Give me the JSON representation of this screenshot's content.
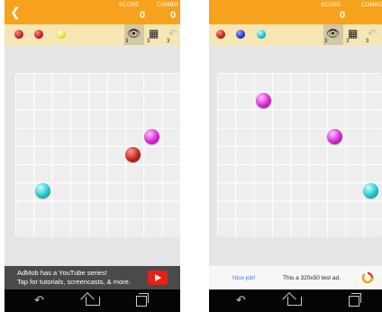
{
  "app": {
    "score_label": "SCORE",
    "combo_label": "COMBO",
    "back_icon": "back-arrow-icon"
  },
  "colors": {
    "accent": "#f6a21c",
    "strip": "#f6e6b3",
    "board": "#eeeeee"
  },
  "screens": [
    {
      "score": "0",
      "combo": "0",
      "preview": [
        {
          "color": "red"
        },
        {
          "color": "red"
        },
        {
          "color": "yellow"
        }
      ],
      "tools": [
        {
          "icon": "eye-icon",
          "count": "3"
        },
        {
          "icon": "qr-grid-icon",
          "count": "3"
        },
        {
          "icon": "undo-icon",
          "count": "3"
        }
      ],
      "board": {
        "cols": 9,
        "rows": 9,
        "balls": [
          {
            "color": "magenta",
            "col": 7,
            "row": 3
          },
          {
            "color": "red",
            "col": 6,
            "row": 4
          },
          {
            "color": "cyan",
            "col": 1,
            "row": 6
          }
        ]
      },
      "ad": {
        "line1": "AdMob has a YouTube series!",
        "line2": "Tap for tutorials, screencasts, & more."
      }
    },
    {
      "score": "0",
      "combo": "COMBO",
      "preview": [
        {
          "color": "red"
        },
        {
          "color": "blue"
        },
        {
          "color": "cyan"
        }
      ],
      "tools": [
        {
          "icon": "eye-icon",
          "count": "3"
        },
        {
          "icon": "qr-grid-icon",
          "count": "3"
        },
        {
          "icon": "undo-icon",
          "count": "3"
        }
      ],
      "board": {
        "cols": 9,
        "rows": 9,
        "balls": [
          {
            "color": "magenta",
            "col": 2,
            "row": 1
          },
          {
            "color": "magenta",
            "col": 6,
            "row": 3
          },
          {
            "color": "cyan",
            "col": 8,
            "row": 6
          }
        ]
      },
      "ad": {
        "nice": "Nice job!",
        "test": "This a 320x50 test ad."
      }
    }
  ]
}
